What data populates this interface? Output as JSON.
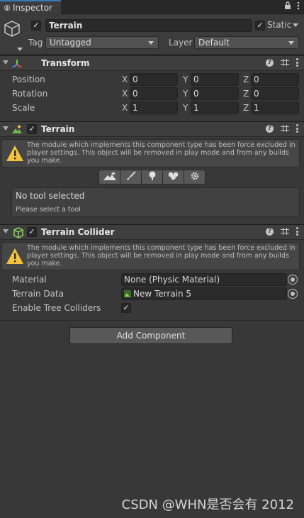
{
  "tab": {
    "label": "Inspector"
  },
  "header": {
    "name": "Terrain",
    "static_label": "Static",
    "tag_label": "Tag",
    "tag_value": "Untagged",
    "layer_label": "Layer",
    "layer_value": "Default"
  },
  "transform": {
    "title": "Transform",
    "rows": [
      {
        "label": "Position",
        "x": "0",
        "y": "0",
        "z": "0"
      },
      {
        "label": "Rotation",
        "x": "0",
        "y": "0",
        "z": "0"
      },
      {
        "label": "Scale",
        "x": "1",
        "y": "1",
        "z": "1"
      }
    ],
    "axis": {
      "x": "X",
      "y": "Y",
      "z": "Z"
    }
  },
  "terrain": {
    "title": "Terrain",
    "warning": "The module which implements this component type has been force excluded in player settings. This object will be removed in play mode and from any builds you make.",
    "tool_title": "No tool selected",
    "tool_hint": "Please select a tool"
  },
  "collider": {
    "title": "Terrain Collider",
    "warning": "The module which implements this component type has been force excluded in player settings. This object will be removed in play mode and from any builds you make.",
    "material_label": "Material",
    "material_value": "None (Physic Material)",
    "data_label": "Terrain Data",
    "data_value": "New Terrain 5",
    "trees_label": "Enable Tree Colliders"
  },
  "add_component": "Add Component",
  "watermark": "CSDN @WHN是否会有 2012",
  "icons": [
    "info-icon",
    "lock-icon",
    "menu-icon",
    "gameobject-icon",
    "transform-icon",
    "terrain-icon",
    "collider-icon",
    "help-icon",
    "preset-icon",
    "warning-icon",
    "raise-terrain-icon",
    "paint-icon",
    "tree-icon",
    "detail-icon",
    "settings-icon",
    "object-picker-icon"
  ]
}
